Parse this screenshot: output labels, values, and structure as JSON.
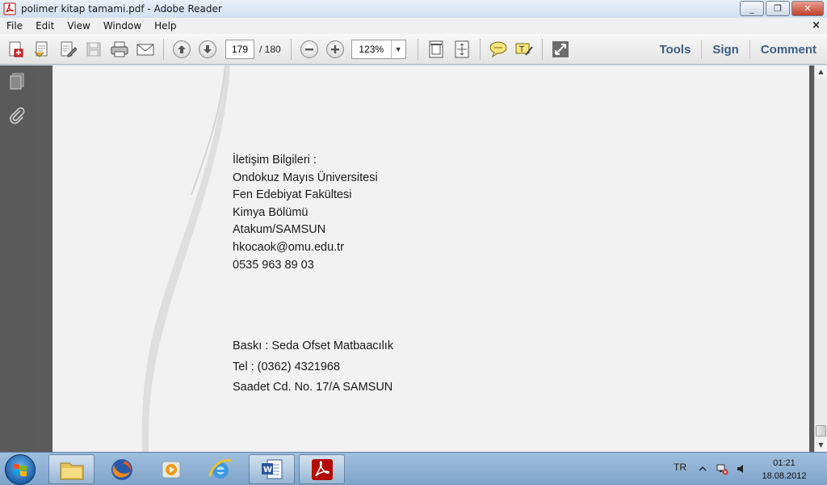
{
  "window": {
    "title": "polimer kitap tamami.pdf - Adobe Reader",
    "controls": {
      "minimize": "▭",
      "maximize": "❐",
      "close": "✕"
    }
  },
  "menu": {
    "items": [
      "File",
      "Edit",
      "View",
      "Window",
      "Help"
    ],
    "doc_close": "×"
  },
  "toolbar": {
    "current_page": "179",
    "page_total": "/ 180",
    "zoom": "123%",
    "zoom_arrow": "▼",
    "links": {
      "tools": "Tools",
      "sign": "Sign",
      "comment": "Comment"
    },
    "icons": [
      "create-pdf-icon",
      "open-icon",
      "edit-icon",
      "save-icon",
      "print-icon",
      "email-icon",
      "previous-page-icon",
      "next-page-icon",
      "zoom-out-icon",
      "zoom-in-icon",
      "fit-page-icon",
      "fit-width-icon",
      "comment-bubble-icon",
      "highlight-icon",
      "full-screen-icon"
    ]
  },
  "navigation_pane": {
    "icons": [
      "pages-icon",
      "attachments-icon"
    ]
  },
  "document": {
    "contact_lines": [
      "İletişim Bilgileri :",
      "Ondokuz Mayıs Üniversitesi",
      "Fen Edebiyat Fakültesi",
      "Kimya Bölümü",
      "Atakum/SAMSUN",
      "hkocaok@omu.edu.tr",
      "0535 963 89 03"
    ],
    "print_lines": [
      "Baskı : Seda Ofset Matbaacılık",
      "Tel : (0362) 4321968",
      "Saadet Cd. No. 17/A SAMSUN"
    ]
  },
  "scrollbar": {
    "up": "▲",
    "down": "▼"
  },
  "taskbar": {
    "apps": [
      "windows-explorer-icon",
      "firefox-icon",
      "media-player-icon",
      "internet-explorer-icon",
      "word-icon",
      "adobe-reader-icon"
    ],
    "language": "TR",
    "tray_icons": [
      "show-hidden-icons-icon",
      "network-icon",
      "volume-icon"
    ],
    "time": "01:21",
    "date": "18.08.2012"
  },
  "colors": {
    "accent_link": "#3d5e86",
    "taskbar": "#8fb1d6",
    "page_background": "#f2f2f2",
    "viewer_background": "#5b5b5b"
  }
}
